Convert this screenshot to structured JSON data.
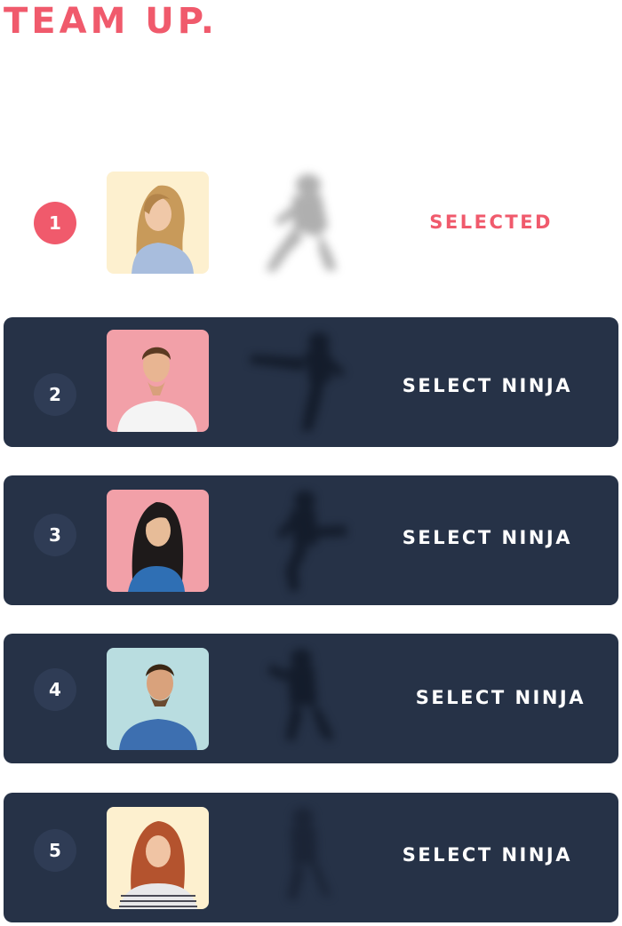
{
  "title": "TEAM UP.",
  "colors": {
    "accent": "#f05a6c",
    "card_background": "#263247",
    "number_badge": "#2f3c55",
    "text_light": "#ffffff"
  },
  "players": [
    {
      "number": "1",
      "status": "SELECTED",
      "selected": true,
      "avatar_bg": "#fdf0cf",
      "pose": "crouching-ninja-silhouette"
    },
    {
      "number": "2",
      "status": "SELECT NINJA",
      "selected": false,
      "avatar_bg": "#f2a0a8",
      "pose": "kicking-ninja-silhouette"
    },
    {
      "number": "3",
      "status": "SELECT NINJA",
      "selected": false,
      "avatar_bg": "#f2a0a8",
      "pose": "jump-kick-ninja-silhouette"
    },
    {
      "number": "4",
      "status": "SELECT NINJA",
      "selected": false,
      "avatar_bg": "#b9dde0",
      "pose": "punching-ninja-silhouette"
    },
    {
      "number": "5",
      "status": "SELECT NINJA",
      "selected": false,
      "avatar_bg": "#fdf0cf",
      "pose": "standing-ninja-silhouette"
    }
  ]
}
